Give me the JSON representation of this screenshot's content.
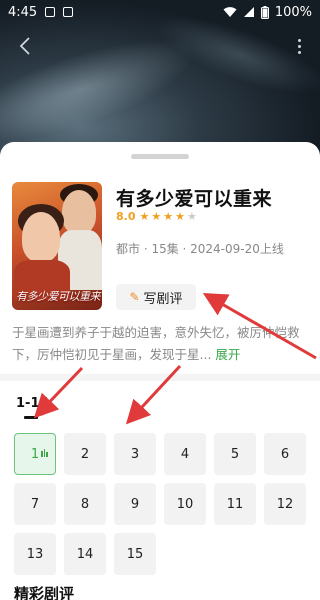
{
  "status_bar": {
    "time": "4:45",
    "battery": "100%"
  },
  "drama": {
    "title": "有多少爱可以重来",
    "score": "8.0",
    "stars": 4,
    "meta": "都市 · 15集 · 2024-09-20上线",
    "poster_title": "有多少爱可以重来",
    "write_review_label": "写剧评",
    "description": "于星画遭到养子于越的迫害，意外失忆，被厉仲恺救下，厉仲恺初见于星画，发现于星...",
    "expand_label": "展开"
  },
  "episodes": {
    "range_tab": "1-15",
    "items": [
      "1",
      "2",
      "3",
      "4",
      "5",
      "6",
      "7",
      "8",
      "9",
      "10",
      "11",
      "12",
      "13",
      "14",
      "15"
    ],
    "active": "1"
  },
  "reviews_section_title": "精彩剧评",
  "colors": {
    "accent_green": "#3aa84a",
    "star_gold": "#f0a020",
    "arrow_red": "#e03a3a"
  }
}
